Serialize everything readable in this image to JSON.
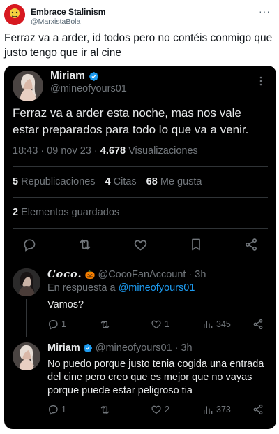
{
  "outer": {
    "name": "Embrace Stalinism",
    "handle": "@MarxistaBola",
    "more": "···",
    "text": "Ferraz va a arder, id todos pero no contéis conmigo que justo tengo que ir al cine"
  },
  "main_tweet": {
    "name": "Miriam",
    "handle": "@mineofyours01",
    "text": "Ferraz va a arder esta noche, mas nos vale estar preparados para todo lo que va a venir.",
    "time_date": "18:43 · 09 nov 23 · ",
    "views_count": "4.678",
    "views_label": " Visualizaciones",
    "reposts_count": "5",
    "reposts_label": " Republicaciones",
    "quotes_count": "4",
    "quotes_label": " Citas",
    "likes_count": "68",
    "likes_label": " Me gusta",
    "bookmarks_count": "2",
    "bookmarks_label": " Elementos guardados"
  },
  "replies": [
    {
      "name": "Coco.",
      "emoji": "🎃",
      "handle": "@CocoFanAccount",
      "time": "· 3h",
      "in_reply_prefix": "En respuesta a ",
      "in_reply_handle": "@mineofyours01",
      "text": "Vamos?",
      "reply_count": "1",
      "like_count": "1",
      "views_count": "345"
    },
    {
      "name": "Miriam",
      "handle": "@mineofyours01",
      "time": "· 3h",
      "text": "No puedo porque justo tenia cogida una entrada del cine pero creo que es mejor que no vayas porque puede estar peligroso tia",
      "reply_count": "1",
      "like_count": "2",
      "views_count": "373"
    }
  ],
  "colors": {
    "accent": "#1d9bf0",
    "card_bg": "#000000",
    "muted": "#71767b",
    "text_dark": "#e7e9ea"
  },
  "icons": [
    "verified-badge-icon",
    "more-icon",
    "reply-icon",
    "repost-icon",
    "like-icon",
    "bookmark-icon",
    "share-icon",
    "views-icon"
  ]
}
